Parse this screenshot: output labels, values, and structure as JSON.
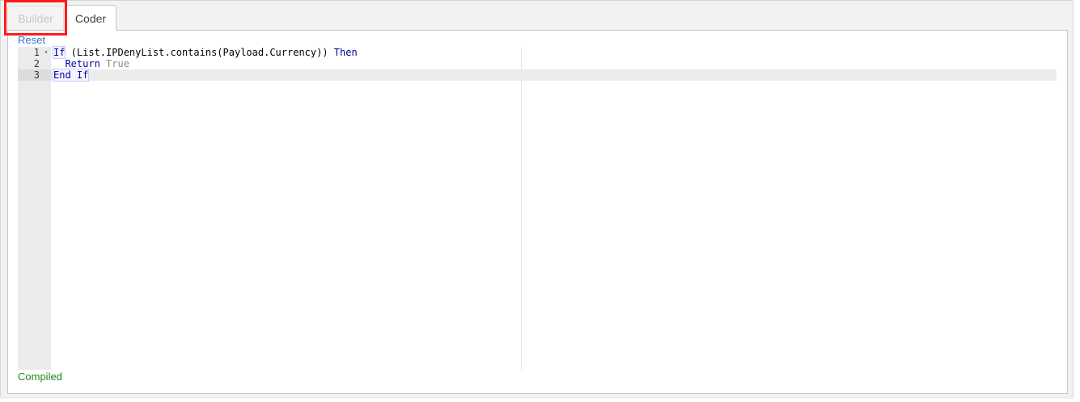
{
  "tabs": {
    "builder": "Builder",
    "coder": "Coder"
  },
  "reset_label": "Reset",
  "editor": {
    "lines": [
      {
        "number": "1",
        "tokens": [
          "If",
          " (List.IPDenyList.contains(Payload.Currency)) ",
          "Then"
        ]
      },
      {
        "number": "2",
        "tokens": [
          "  ",
          "Return",
          " ",
          "True"
        ]
      },
      {
        "number": "3",
        "tokens": [
          "End",
          " ",
          "If"
        ]
      }
    ]
  },
  "status_text": "Compiled",
  "colors": {
    "highlight": "#ff1a1a",
    "keyword": "#0000a8",
    "link": "#2a7bd0",
    "status": "#1a8a1a"
  },
  "icons": {
    "fold": "fold-toggle-icon"
  }
}
